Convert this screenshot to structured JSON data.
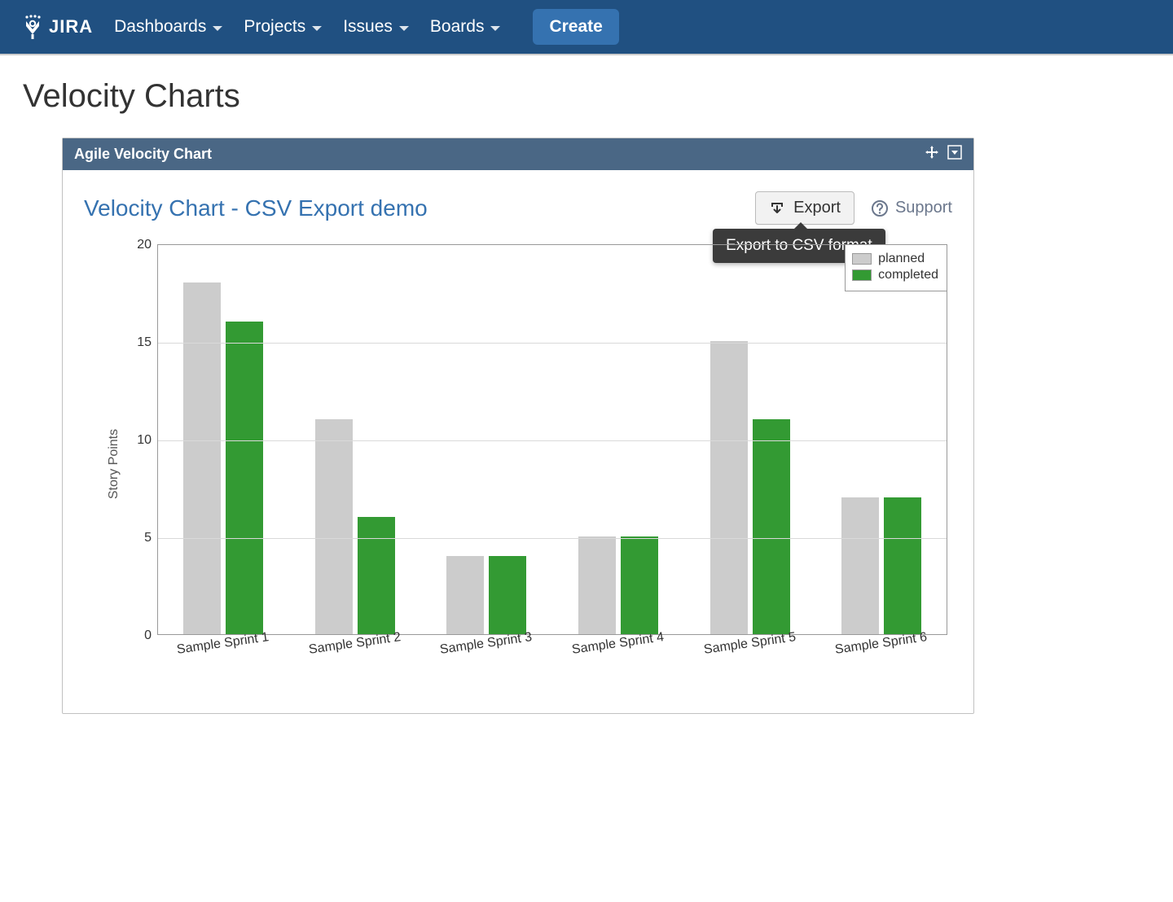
{
  "nav": {
    "brand": "JIRA",
    "items": [
      "Dashboards",
      "Projects",
      "Issues",
      "Boards"
    ],
    "create": "Create"
  },
  "page": {
    "title": "Velocity Charts"
  },
  "gadget": {
    "header": "Agile Velocity Chart",
    "title": "Velocity Chart - CSV Export demo",
    "export_label": "Export",
    "export_tooltip": "Export to CSV format",
    "support_label": "Support"
  },
  "legend": {
    "planned": "planned",
    "completed": "completed"
  },
  "chart_data": {
    "type": "bar",
    "title": "Velocity Chart - CSV Export demo",
    "xlabel": "",
    "ylabel": "Story Points",
    "categories": [
      "Sample Sprint 1",
      "Sample Sprint 2",
      "Sample Sprint 3",
      "Sample Sprint 4",
      "Sample Sprint 5",
      "Sample Sprint 6"
    ],
    "series": [
      {
        "name": "planned",
        "values": [
          18,
          11,
          4,
          5,
          15,
          7
        ]
      },
      {
        "name": "completed",
        "values": [
          16,
          6,
          4,
          5,
          11,
          7
        ]
      }
    ],
    "ylim": [
      0,
      20
    ],
    "yticks": [
      0,
      5,
      10,
      15,
      20
    ],
    "colors": {
      "planned": "#cccccc",
      "completed": "#339a33"
    },
    "legend_position": "top-right",
    "grid": true
  }
}
